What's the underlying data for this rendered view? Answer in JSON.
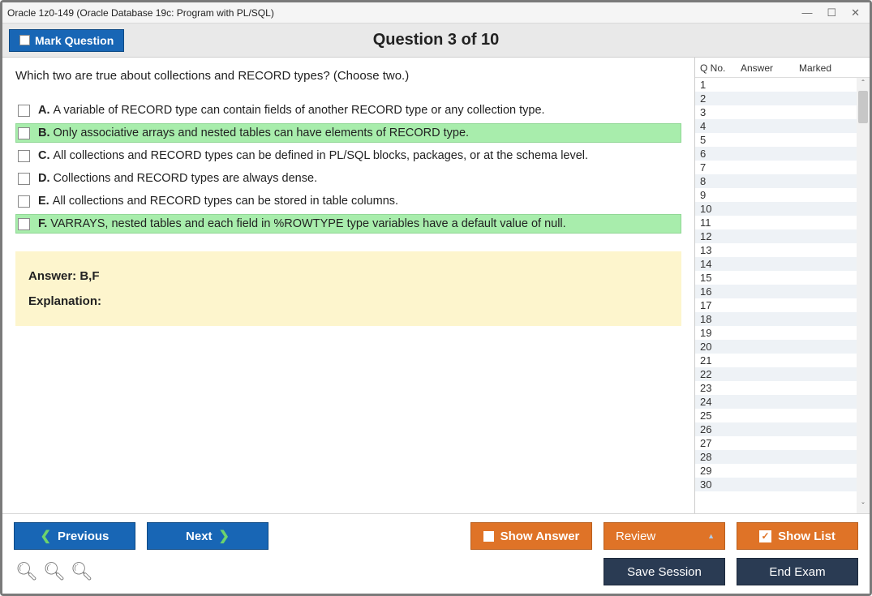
{
  "window": {
    "title": "Oracle 1z0-149 (Oracle Database 19c: Program with PL/SQL)"
  },
  "header": {
    "mark_label": "Mark Question",
    "question_title": "Question 3 of 10"
  },
  "question": {
    "stem": "Which two are true about collections and RECORD types? (Choose two.)",
    "choices": [
      {
        "letter": "A.",
        "text": "A variable of RECORD type can contain fields of another RECORD type or any collection type.",
        "correct": false
      },
      {
        "letter": "B.",
        "text": "Only associative arrays and nested tables can have elements of RECORD type.",
        "correct": true
      },
      {
        "letter": "C.",
        "text": "All collections and RECORD types can be defined in PL/SQL blocks, packages, or at the schema level.",
        "correct": false
      },
      {
        "letter": "D.",
        "text": "Collections and RECORD types are always dense.",
        "correct": false
      },
      {
        "letter": "E.",
        "text": "All collections and RECORD types can be stored in table columns.",
        "correct": false
      },
      {
        "letter": "F.",
        "text": "VARRAYS, nested tables and each field in %ROWTYPE type variables have a default value of null.",
        "correct": true
      }
    ],
    "answer_label": "Answer: B,F",
    "explanation_label": "Explanation:"
  },
  "sidebar": {
    "headers": {
      "qno": "Q No.",
      "answer": "Answer",
      "marked": "Marked"
    },
    "rows": [
      1,
      2,
      3,
      4,
      5,
      6,
      7,
      8,
      9,
      10,
      11,
      12,
      13,
      14,
      15,
      16,
      17,
      18,
      19,
      20,
      21,
      22,
      23,
      24,
      25,
      26,
      27,
      28,
      29,
      30
    ]
  },
  "footer": {
    "previous": "Previous",
    "next": "Next",
    "show_answer": "Show Answer",
    "review": "Review",
    "show_list": "Show List",
    "save_session": "Save Session",
    "end_exam": "End Exam"
  }
}
